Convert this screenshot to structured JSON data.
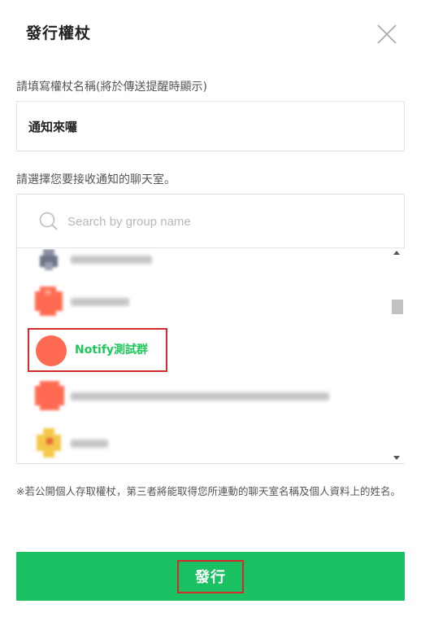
{
  "header": {
    "title": "發行權杖",
    "close_icon": "close-icon"
  },
  "token": {
    "label": "請填寫權杖名稱(將於傳送提醒時顯示)",
    "value": "通知來囉"
  },
  "room": {
    "label": "請選擇您要接收通知的聊天室。",
    "search_placeholder": "Search by group name",
    "selected_name": "Notify測試群"
  },
  "notice": "※若公開個人存取權杖，第三者將能取得您所連動的聊天室名稱及個人資料上的姓名。",
  "actions": {
    "issue_label": "發行"
  },
  "colors": {
    "accent": "#19c163",
    "highlight_border": "#d32b2b",
    "selected_text": "#1ec85a",
    "avatar": "#ff6b52"
  }
}
